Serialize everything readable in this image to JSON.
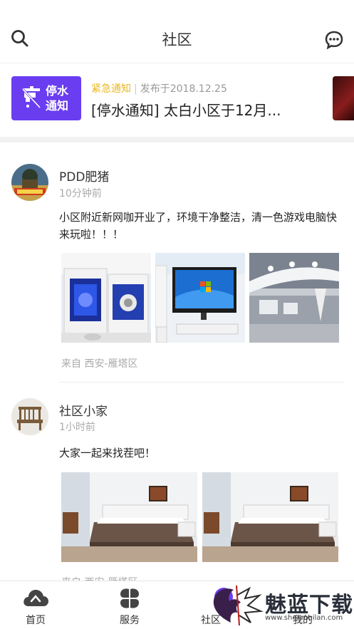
{
  "header": {
    "title": "社区",
    "search_icon": "search-icon",
    "message_icon": "chat-icon"
  },
  "notice": {
    "badge_text": "停水通知",
    "tag": "紧急通知",
    "separator": "|",
    "date": "发布于2018.12.25",
    "headline": "[停水通知] 太白小区于12月..."
  },
  "posts": [
    {
      "name": "PDD肥猪",
      "time": "10分钟前",
      "text": "小区附近新网咖开业了，环境干净整洁，清一色游戏电脑快来玩啦！！！",
      "location": "来自  西安-雁塔区"
    },
    {
      "name": "社区小家",
      "time": "1小时前",
      "text": "大家一起来找茬吧！",
      "location": "来自  西安-雁塔区"
    }
  ],
  "tabbar": {
    "items": [
      {
        "label": "首页",
        "icon": "cloud-icon"
      },
      {
        "label": "服务",
        "icon": "clover-icon"
      },
      {
        "label": "社区",
        "icon": "community-icon"
      },
      {
        "label": "我的",
        "icon": "user-icon"
      }
    ]
  },
  "watermark": {
    "text": "魅蓝下载",
    "url": "www.shenmeilan.com"
  },
  "colors": {
    "accent": "#6a3df0",
    "tag": "#e8b923"
  }
}
